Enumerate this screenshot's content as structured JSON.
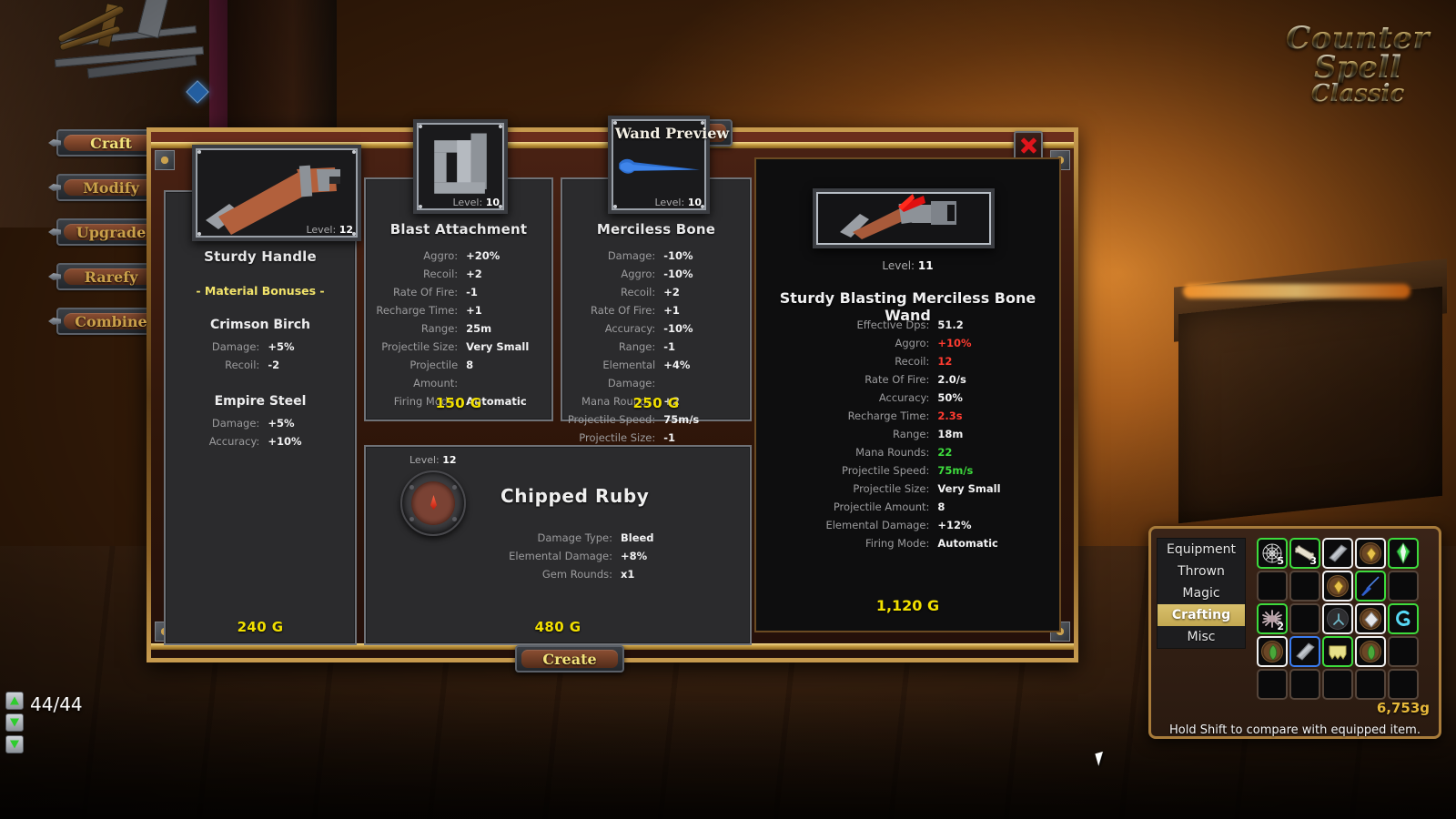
{
  "game": {
    "logo_line1": "Counter",
    "logo_line2": "Spell",
    "logo_line3": "Classic"
  },
  "hud": {
    "ammo_count": "44/44",
    "button_up_icon": "arrow-up-icon",
    "button_down_icon": "arrow-down-icon",
    "button_download_icon": "arrow-download-icon"
  },
  "sidebar": {
    "items": [
      {
        "label": "Craft",
        "active": true
      },
      {
        "label": "Modify",
        "active": false
      },
      {
        "label": "Upgrade",
        "active": false
      },
      {
        "label": "Rarefy",
        "active": false
      },
      {
        "label": "Combine",
        "active": false
      }
    ]
  },
  "window": {
    "title": "Wand Preview",
    "close_icon": "close-x-icon",
    "create_label": "Create"
  },
  "components": [
    {
      "name": "Sturdy Handle",
      "level_label": "Level:",
      "level": "12",
      "price": "240 G",
      "material_header": "- Material Bonuses -",
      "materials": [
        {
          "name": "Crimson Birch",
          "stats": [
            {
              "key": "Damage:",
              "value": "+5%"
            },
            {
              "key": "Recoil:",
              "value": "-2"
            }
          ]
        },
        {
          "name": "Empire Steel",
          "stats": [
            {
              "key": "Damage:",
              "value": "+5%"
            },
            {
              "key": "Accuracy:",
              "value": "+10%"
            }
          ]
        }
      ]
    },
    {
      "name": "Blast Attachment",
      "level_label": "Level:",
      "level": "10",
      "price": "150 G",
      "stats": [
        {
          "key": "Aggro:",
          "value": "+20%"
        },
        {
          "key": "Recoil:",
          "value": "+2"
        },
        {
          "key": "Rate Of Fire:",
          "value": "-1"
        },
        {
          "key": "Recharge Time:",
          "value": "+1"
        },
        {
          "key": "Range:",
          "value": "25m"
        },
        {
          "key": "Projectile Size:",
          "value": "Very Small"
        },
        {
          "key": "Projectile Amount:",
          "value": "8"
        },
        {
          "key": "Firing Mode:",
          "value": "Automatic"
        }
      ]
    },
    {
      "name": "Merciless Bone",
      "level_label": "Level:",
      "level": "10",
      "price": "250 G",
      "stats": [
        {
          "key": "Damage:",
          "value": "-10%"
        },
        {
          "key": "Aggro:",
          "value": "-10%"
        },
        {
          "key": "Recoil:",
          "value": "+2"
        },
        {
          "key": "Rate Of Fire:",
          "value": "+1"
        },
        {
          "key": "Accuracy:",
          "value": "-10%"
        },
        {
          "key": "Range:",
          "value": "-1"
        },
        {
          "key": "Elemental Damage:",
          "value": "+4%"
        },
        {
          "key": "Mana Rounds:",
          "value": "+2"
        },
        {
          "key": "Projectile Speed:",
          "value": "75m/s"
        },
        {
          "key": "Projectile Size:",
          "value": "-1"
        }
      ]
    }
  ],
  "gem": {
    "name": "Chipped Ruby",
    "level_label": "Level:",
    "level": "12",
    "price": "480 G",
    "stats": [
      {
        "key": "Damage Type:",
        "value": "Bleed"
      },
      {
        "key": "Elemental Damage:",
        "value": "+8%"
      },
      {
        "key": "Gem Rounds:",
        "value": "x1"
      }
    ]
  },
  "preview": {
    "level_label": "Level:",
    "level": "11",
    "item_name": "Sturdy Blasting Merciless Bone Wand",
    "price": "1,120 G",
    "stats": [
      {
        "key": "Effective Dps:",
        "value": "51.2",
        "color": "#f2f2f3"
      },
      {
        "key": "Aggro:",
        "value": "+10%",
        "color": "#ff3b30"
      },
      {
        "key": "Recoil:",
        "value": "12",
        "color": "#ff3b30"
      },
      {
        "key": "Rate Of Fire:",
        "value": "2.0/s",
        "color": "#f2f2f3"
      },
      {
        "key": "Accuracy:",
        "value": "50%",
        "color": "#f2f2f3"
      },
      {
        "key": "Recharge Time:",
        "value": "2.3s",
        "color": "#ff3b30"
      },
      {
        "key": "Range:",
        "value": "18m",
        "color": "#f2f2f3"
      },
      {
        "key": "Mana Rounds:",
        "value": "22",
        "color": "#3ddb3d"
      },
      {
        "key": "Projectile Speed:",
        "value": "75m/s",
        "color": "#3ddb3d"
      },
      {
        "key": "Projectile Size:",
        "value": "Very Small",
        "color": "#f2f2f3"
      },
      {
        "key": "Projectile Amount:",
        "value": "8",
        "color": "#f2f2f3"
      },
      {
        "key": "Elemental Damage:",
        "value": "+12%",
        "color": "#f2f2f3"
      },
      {
        "key": "Firing Mode:",
        "value": "Automatic",
        "color": "#f2f2f3"
      }
    ]
  },
  "inventory": {
    "tabs": [
      {
        "label": "Equipment",
        "active": false
      },
      {
        "label": "Thrown",
        "active": false
      },
      {
        "label": "Magic",
        "active": false
      },
      {
        "label": "Crafting",
        "active": true
      },
      {
        "label": "Misc",
        "active": false
      }
    ],
    "gold": "6,753g",
    "hint": "Hold Shift to compare with equipped item.",
    "slots": [
      {
        "icon": "web-bundle-icon",
        "rarity": "g",
        "qty": "5"
      },
      {
        "icon": "bone-icon",
        "rarity": "g",
        "qty": "3"
      },
      {
        "icon": "metal-bar-icon",
        "rarity": "w",
        "qty": ""
      },
      {
        "icon": "gold-nugget-disc-icon",
        "rarity": "w",
        "qty": ""
      },
      {
        "icon": "green-crystal-icon",
        "rarity": "g",
        "qty": ""
      },
      {
        "icon": "",
        "rarity": "empty",
        "qty": ""
      },
      {
        "icon": "",
        "rarity": "empty",
        "qty": ""
      },
      {
        "icon": "gold-nugget-disc-icon",
        "rarity": "w",
        "qty": ""
      },
      {
        "icon": "blue-arrow-icon",
        "rarity": "g",
        "qty": ""
      },
      {
        "icon": "",
        "rarity": "empty",
        "qty": ""
      },
      {
        "icon": "fiber-cluster-icon",
        "rarity": "g",
        "qty": "2"
      },
      {
        "icon": "",
        "rarity": "empty",
        "qty": ""
      },
      {
        "icon": "rune-disc-icon",
        "rarity": "w",
        "qty": ""
      },
      {
        "icon": "diamond-disc-icon",
        "rarity": "w",
        "qty": ""
      },
      {
        "icon": "blue-swirl-icon",
        "rarity": "g",
        "qty": ""
      },
      {
        "icon": "green-leaf-disc-icon",
        "rarity": "w",
        "qty": ""
      },
      {
        "icon": "metal-bar-icon",
        "rarity": "b",
        "qty": ""
      },
      {
        "icon": "yellow-cloth-icon",
        "rarity": "g",
        "qty": ""
      },
      {
        "icon": "green-leaf-disc-icon",
        "rarity": "w",
        "qty": ""
      },
      {
        "icon": "",
        "rarity": "empty",
        "qty": ""
      },
      {
        "icon": "",
        "rarity": "empty",
        "qty": ""
      },
      {
        "icon": "",
        "rarity": "empty",
        "qty": ""
      },
      {
        "icon": "",
        "rarity": "empty",
        "qty": ""
      },
      {
        "icon": "",
        "rarity": "empty",
        "qty": ""
      },
      {
        "icon": "",
        "rarity": "empty",
        "qty": ""
      }
    ]
  }
}
